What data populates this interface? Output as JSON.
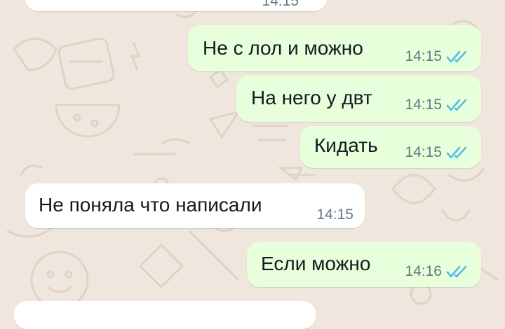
{
  "chat": {
    "previous_partial": {
      "time": "14:15"
    },
    "messages": [
      {
        "direction": "out",
        "text": "Не с лол и можно",
        "time": "14:15",
        "status": "read-double-check-icon"
      },
      {
        "direction": "out",
        "text": "На него у двт",
        "time": "14:15",
        "status": "read-double-check-icon"
      },
      {
        "direction": "out",
        "text": "Кидать",
        "time": "14:15",
        "status": "read-double-check-icon"
      },
      {
        "direction": "in",
        "text": "Не поняла что написали",
        "time": "14:15"
      },
      {
        "direction": "out",
        "text": "Если можно",
        "time": "14:16",
        "status": "read-double-check-icon"
      }
    ]
  },
  "colors": {
    "background": "#efe7de",
    "outgoing_bubble": "#e7ffdb",
    "incoming_bubble": "#ffffff",
    "read_ticks": "#53bdeb",
    "timestamp": "#667781"
  }
}
